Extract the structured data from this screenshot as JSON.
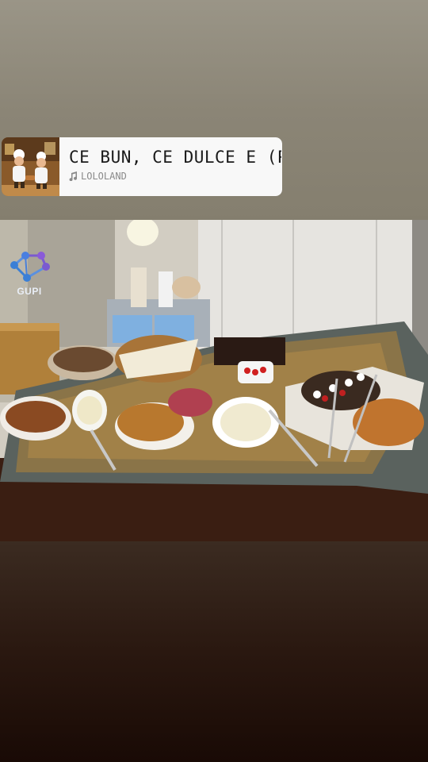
{
  "music_sticker": {
    "title": "CE BUN, CE DULCE E (PLĂCINTA)",
    "artist": "LOLOLAND",
    "icon": "music-note-icon"
  },
  "overlay_logo": {
    "text": "GUPI",
    "icon": "gupi-network-logo"
  },
  "colors": {
    "logo_blue": "#3b7fd6",
    "logo_purple": "#7a5ad0",
    "sticker_bg": "#f8f8f8"
  }
}
